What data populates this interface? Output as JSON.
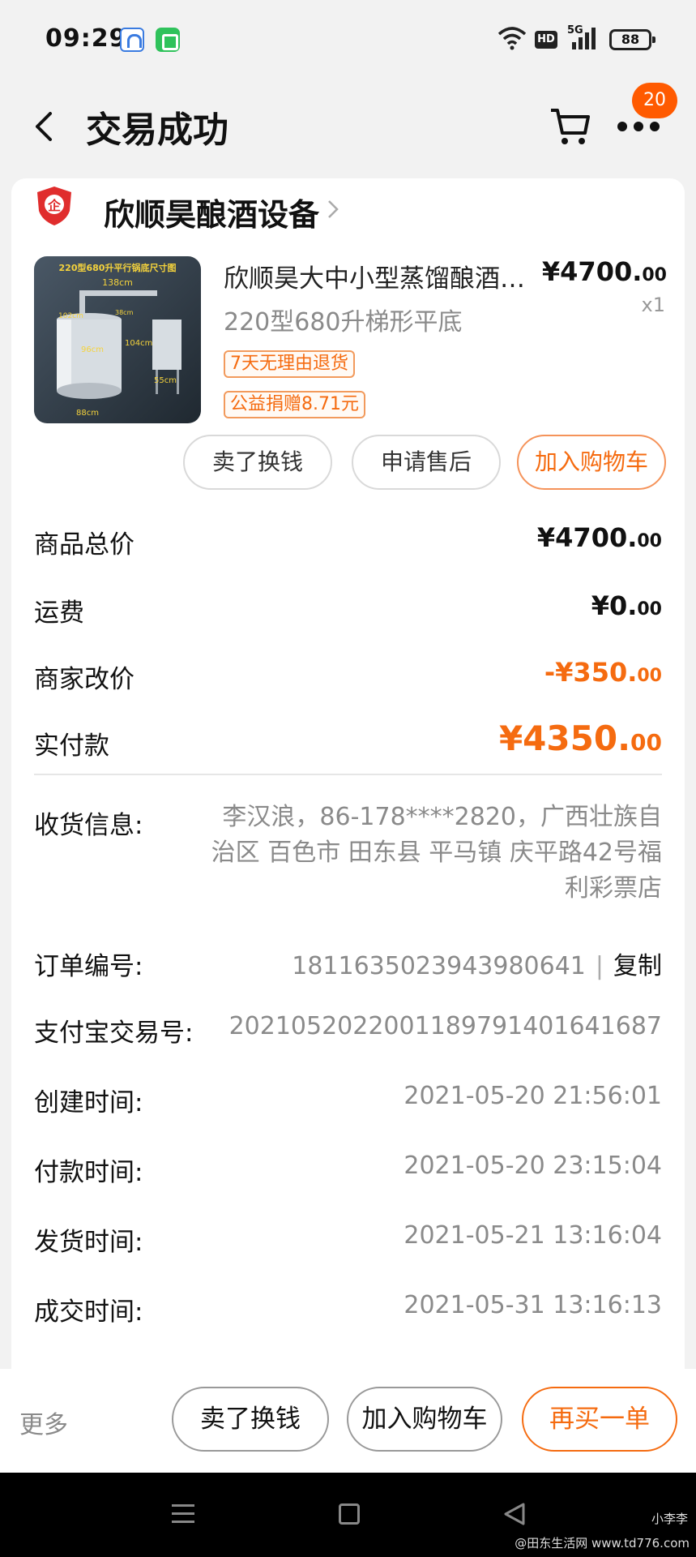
{
  "status": {
    "time": "09:29",
    "hd": "HD",
    "network": "5G",
    "battery": "88"
  },
  "header": {
    "title": "交易成功",
    "badge": "20"
  },
  "shop": {
    "name": "欣顺昊酿酒设备",
    "logo_text": "企"
  },
  "product": {
    "title": "欣顺昊大中小型蒸馏酿酒…",
    "sku": "220型680升梯形平底",
    "price_int": "¥4700.",
    "price_dec": "00",
    "qty": "x1",
    "tags": [
      "7天无理由退货",
      "公益捐赠8.71元"
    ],
    "image_caption": "220型680升平行锅底尺寸图",
    "dims": [
      "138cm",
      "104cm",
      "96cm",
      "55cm",
      "88cm",
      "38cm",
      "102cm"
    ],
    "actions": [
      "卖了换钱",
      "申请售后",
      "加入购物车"
    ]
  },
  "summary": [
    {
      "label": "商品总价",
      "int": "¥4700.",
      "dec": "00"
    },
    {
      "label": "运费",
      "int": "¥0.",
      "dec": "00"
    },
    {
      "label": "商家改价",
      "int": "-¥350.",
      "dec": "00"
    },
    {
      "label": "实付款",
      "int": "¥4350.",
      "dec": "00"
    }
  ],
  "info": {
    "address_label": "收货信息:",
    "address": "李汉浪，86-178****2820，广西壮族自治区 百色市 田东县 平马镇 庆平路42号福利彩票店",
    "order_label": "订单编号:",
    "order_no": "1811635023943980641",
    "copy": "复制",
    "alipay_label": "支付宝交易号:",
    "alipay_no": "2021052022001189791401641687",
    "created_label": "创建时间:",
    "created": "2021-05-20 21:56:01",
    "paid_label": "付款时间:",
    "paid": "2021-05-20 23:15:04",
    "shipped_label": "发货时间:",
    "shipped": "2021-05-21 13:16:04",
    "closed_label": "成交时间:",
    "closed": "2021-05-31 13:16:13"
  },
  "bottom": {
    "more": "更多",
    "sell": "卖了换钱",
    "add_cart": "加入购物车",
    "rebuy": "再买一单"
  },
  "watermark": {
    "user": "小李李",
    "site": "@田东生活网 www.td776.com"
  },
  "colors": {
    "accent": "#f56b10",
    "badge": "#ff5a00"
  }
}
